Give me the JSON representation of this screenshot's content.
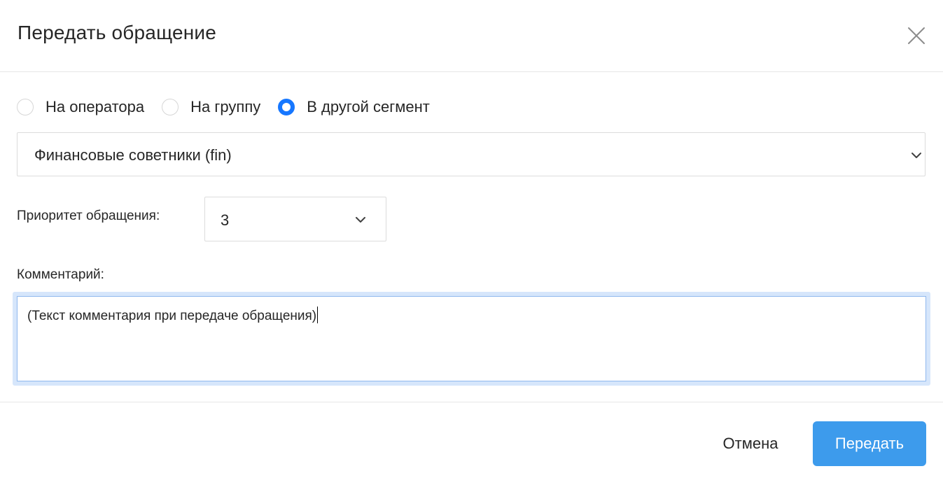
{
  "dialog": {
    "title": "Передать обращение",
    "close_icon": "close-icon"
  },
  "transfer_target": {
    "options": [
      {
        "label": "На оператора",
        "checked": false
      },
      {
        "label": "На группу",
        "checked": false
      },
      {
        "label": "В другой сегмент",
        "checked": true
      }
    ]
  },
  "segment_select": {
    "value": "Финансовые советники (fin)",
    "icon": "chevron-down-icon"
  },
  "priority": {
    "label": "Приоритет обращения:",
    "value": "3",
    "icon": "chevron-down-icon"
  },
  "comment": {
    "label": "Комментарий:",
    "value": "(Текст комментария при передаче обращения)"
  },
  "footer": {
    "cancel_label": "Отмена",
    "submit_label": "Передать"
  },
  "colors": {
    "accent": "#1677ff",
    "submit_button": "#3d9bec",
    "focus_border": "#8fb8ee",
    "border": "#dcdcdc",
    "text": "#262626"
  }
}
